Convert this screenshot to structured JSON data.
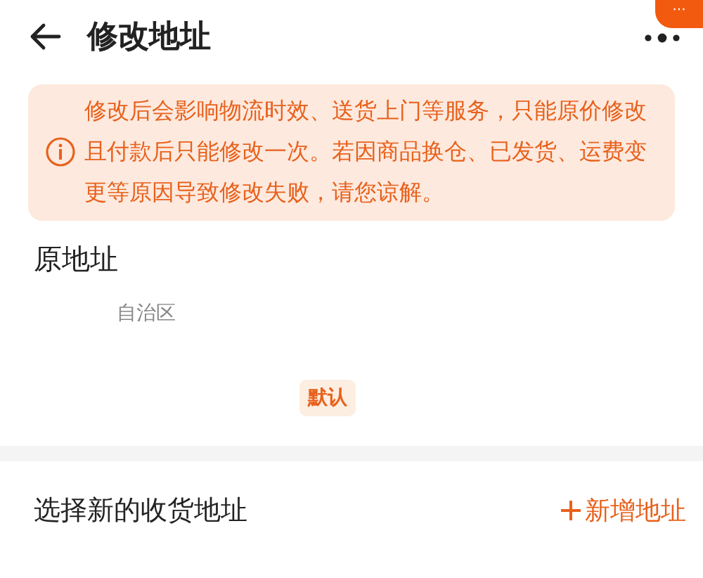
{
  "header": {
    "title": "修改地址",
    "badge": "···"
  },
  "notice": {
    "text": "修改后会影响物流时效、送货上门等服务，只能原价修改且付款后只能修改一次。若因商品换仓、已发货、运费变更等原因导致修改失败，请您谅解。"
  },
  "original_address": {
    "heading": "原地址",
    "address": "自治区",
    "default_tag": "默认"
  },
  "new_address": {
    "heading": "选择新的收货地址",
    "add_link": "新增地址"
  }
}
